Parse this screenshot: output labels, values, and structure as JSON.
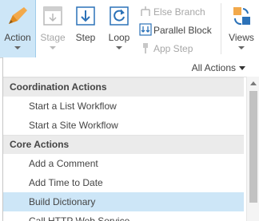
{
  "ribbon": {
    "action": {
      "label": "Action",
      "icon": "action-pen-icon",
      "state": "pressed"
    },
    "stage": {
      "label": "Stage",
      "icon": "stage-icon",
      "state": "disabled"
    },
    "step": {
      "label": "Step",
      "icon": "step-arrow-down-icon"
    },
    "loop": {
      "label": "Loop",
      "icon": "loop-refresh-icon"
    },
    "else_branch": {
      "label": "Else Branch",
      "icon": "else-branch-icon",
      "state": "disabled"
    },
    "parallel_block": {
      "label": "Parallel Block",
      "icon": "parallel-block-icon"
    },
    "app_step": {
      "label": "App Step",
      "icon": "app-step-icon",
      "state": "disabled"
    },
    "views": {
      "label": "Views",
      "icon": "views-icon"
    }
  },
  "dropdown": {
    "filter_label": "All Actions",
    "categories": [
      {
        "name": "Coordination Actions",
        "items": [
          {
            "label": "Start a List Workflow"
          },
          {
            "label": "Start a Site Workflow"
          }
        ]
      },
      {
        "name": "Core Actions",
        "items": [
          {
            "label": "Add a Comment"
          },
          {
            "label": "Add Time to Date"
          },
          {
            "label": "Build Dictionary",
            "selected": true
          },
          {
            "label": "Call HTTP Web Service"
          }
        ]
      }
    ]
  },
  "colors": {
    "accent": "#cde6f7",
    "icon_blue": "#2c72b8",
    "icon_orange": "#f2a94b"
  }
}
